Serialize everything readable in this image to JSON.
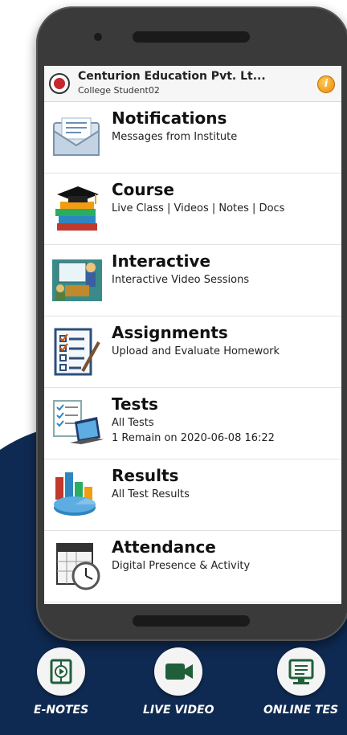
{
  "header": {
    "institute_name": "Centurion Education Pvt. Lt...",
    "user_name": "College Student02",
    "info_symbol": "i"
  },
  "menu": [
    {
      "icon": "envelope-icon",
      "title": "Notifications",
      "subtitle": "Messages from Institute"
    },
    {
      "icon": "graduation-books-icon",
      "title": "Course",
      "subtitle": "Live Class | Videos | Notes | Docs"
    },
    {
      "icon": "teacher-board-icon",
      "title": "Interactive",
      "subtitle": "Interactive Video Sessions"
    },
    {
      "icon": "checklist-pen-icon",
      "title": "Assignments",
      "subtitle": "Upload and Evaluate Homework"
    },
    {
      "icon": "laptop-checklist-icon",
      "title": "Tests",
      "subtitle": "All Tests",
      "detail": "1 Remain on 2020-06-08 16:22"
    },
    {
      "icon": "bar-pie-chart-icon",
      "title": "Results",
      "subtitle": "All Test Results"
    },
    {
      "icon": "calendar-clock-icon",
      "title": "Attendance",
      "subtitle": "Digital Presence & Activity"
    }
  ],
  "features": [
    {
      "icon": "book-play-icon",
      "label": "E-NOTES"
    },
    {
      "icon": "video-camera-icon",
      "label": "LIVE VIDEO"
    },
    {
      "icon": "monitor-icon",
      "label": "ONLINE TES"
    }
  ],
  "colors": {
    "backdrop": "#0f2a52",
    "feature_icon": "#1f5f3a",
    "phone_body": "#3a3a3a"
  }
}
